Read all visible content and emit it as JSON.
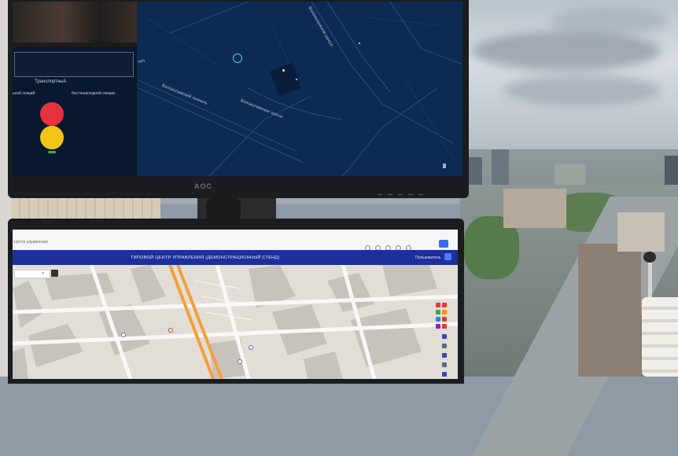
{
  "top_monitor": {
    "brand": "AOC",
    "panel_title": "Транспортный",
    "col_left": "ьной секций",
    "col_right": "без пешеходной секции",
    "lights": [
      {
        "name": "red-light",
        "color": "#e6323e"
      },
      {
        "name": "yellow-light",
        "color": "#f2c418"
      }
    ],
    "map_labels": {
      "tunnel": "Волоколамский тоннель",
      "highway": "Волоколамское шоссе",
      "highway2": "Волоколамское шоссе",
      "edge": "ксп"
    }
  },
  "bottom_monitor": {
    "breadcrumb": "Центр управления",
    "title": "ТИПОВОЙ ЦЕНТР УПРАВЛЕНИЯ (ДЕМОНСТРАЦИОННЫЙ СТЕНД)",
    "user": "Пользователь",
    "search_icon": "search-icon"
  }
}
